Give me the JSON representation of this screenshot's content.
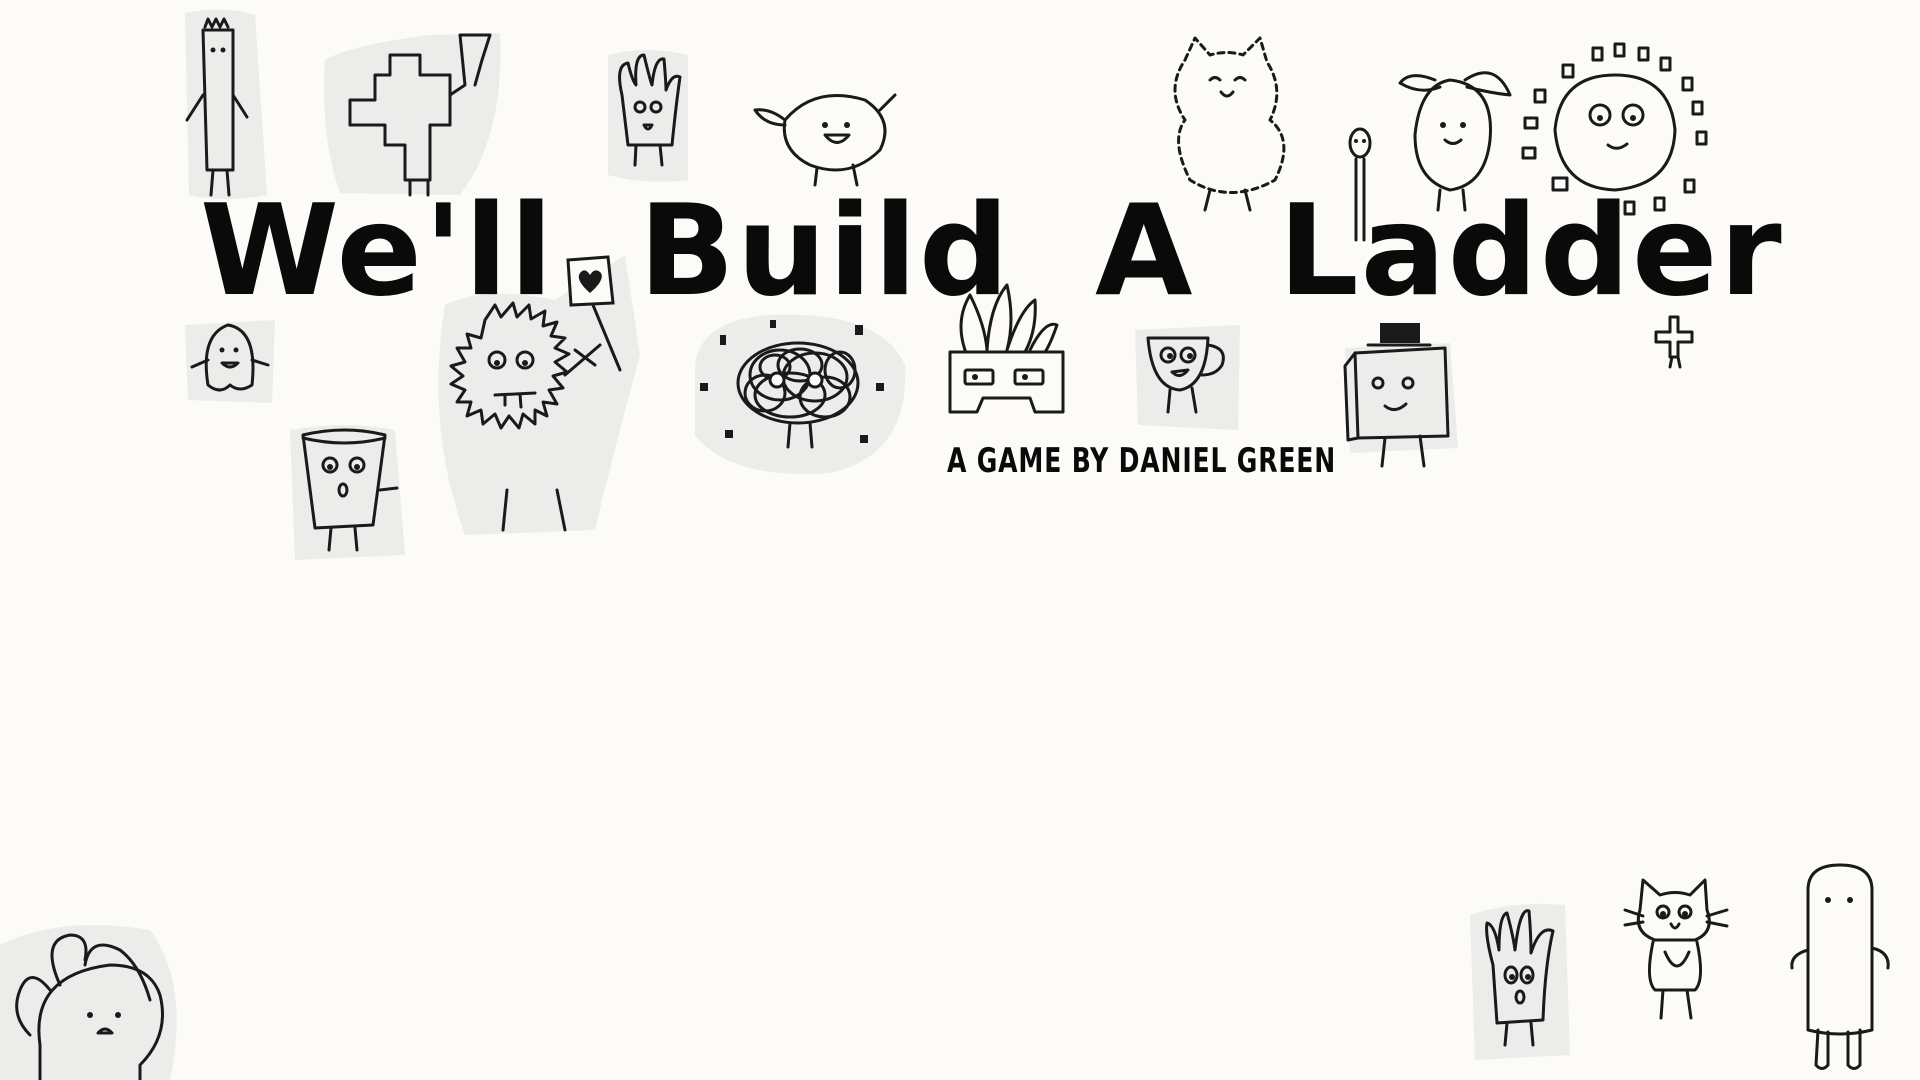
{
  "title_screen": {
    "title": "We'll Build A Ladder",
    "subtitle": "A GAME BY DANIEL GREEN"
  },
  "palette": {
    "background": "#fcfbf7",
    "ink": "#1a1a1a",
    "paper_cutout": "#ececea"
  },
  "doodles": [
    "tall-block-character-icon",
    "maze-creature-icon",
    "hand-creature-icon",
    "lemon-creature-icon",
    "cat-creature-icon",
    "match-stick-icon",
    "lemon-with-leaves-icon",
    "sun-creature-icon",
    "ghost-blob-icon",
    "fuzzy-monster-with-heart-sign-icon",
    "scribble-creature-icon",
    "plant-pot-creature-icon",
    "mug-creature-icon",
    "hat-box-creature-icon",
    "small-cross-creature-icon",
    "paper-cup-creature-icon",
    "peeking-creature-icon",
    "glove-creature-icon",
    "cat-with-bib-icon",
    "tall-cylinder-creature-icon"
  ]
}
